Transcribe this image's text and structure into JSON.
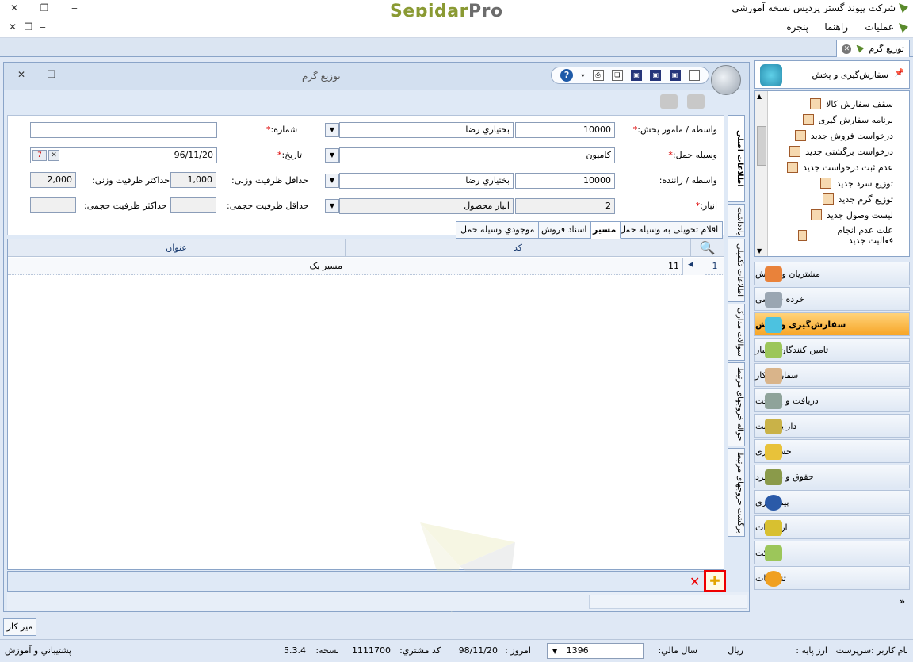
{
  "app": {
    "title": "شرکت پیوند گستر پردیس نسخه آموزشی",
    "logo_main": "Sepidar",
    "logo_pro": "Pro"
  },
  "menu": {
    "items": [
      "عملیات",
      "راهنما",
      "پنجره"
    ]
  },
  "doc_tab": {
    "label": "توزیع گرم"
  },
  "window": {
    "title": "توزیع گرم"
  },
  "form": {
    "agent_label": "واسطه / مامور پخش:",
    "agent_code": "10000",
    "agent_name": "بختياري رضا",
    "number_label": "شماره:",
    "number_value": "",
    "vehicle_label": "وسیله حمل:",
    "vehicle_value": "کامیون",
    "date_label": "تاریخ:",
    "date_value": "96/11/20",
    "driver_label": "واسطه / راننده:",
    "driver_code": "10000",
    "driver_name": "بختياري رضا",
    "min_weight_label": "حداقل ظرفیت وزنی:",
    "min_weight_value": "1,000",
    "max_weight_label": "حداکثر ظرفیت وزنی:",
    "max_weight_value": "2,000",
    "warehouse_label": "انبار:",
    "warehouse_code": "2",
    "warehouse_name": "انبار محصول",
    "min_volume_label": "حداقل ظرفیت حجمی:",
    "min_volume_value": "",
    "max_volume_label": "حداکثر ظرفیت حجمی:",
    "max_volume_value": ""
  },
  "sub_tabs": [
    "اقلام تحویلی به وسیله حمل",
    "مسیر",
    "اسناد فروش",
    "موجودي وسيله حمل"
  ],
  "grid": {
    "columns": [
      "کد",
      "عنوان"
    ],
    "rows": [
      {
        "index": "1",
        "code": "11",
        "title": "مسیر یک"
      }
    ]
  },
  "vertical_tabs": [
    "اطلاعات اصلی",
    "یادداشت",
    "اطلاعات تکمیلی",
    "سوالات مدارک",
    "حواله خروجهای مرتبط",
    "برگشت خروجهای مرتبط"
  ],
  "right_panel": {
    "header": "سفارش‌گیری و پخش",
    "items": [
      "سقف سفارش کالا",
      "برنامه سفارش گیری",
      "درخواست فروش جدید",
      "درخواست برگشتی جدید",
      "عدم ثبت درخواست جدید",
      "توزیع سرد جدید",
      "توزیع گرم جدید",
      "لیست وصول جدید",
      "علت عدم انجام فعالیت جدید"
    ],
    "categories": [
      "مشتریان و فروش",
      "خرده فروشی",
      "سفارش‌گیری و پخش",
      "تامین کنندگان و انبار",
      "سفارش کار",
      "دریافت و پرداخت",
      "دارایی ثابت",
      "حسابداری",
      "حقوق و دستمزد",
      "پیمانکاری",
      "ارتباطات",
      "شرکت",
      "تنظیمات"
    ]
  },
  "bottom": {
    "desk_button": "میز کار"
  },
  "footer": {
    "user_label": "نام کاربر :سرپرست",
    "currency_label": "ارز پایه :",
    "currency_value": "ریال",
    "fiscal_label": "سال مالي:",
    "fiscal_value": "1396",
    "today_label": "امروز :",
    "today_value": "98/11/20",
    "customer_label": "کد مشتري:",
    "customer_value": "1111700",
    "version_label": "نسخه:",
    "version_value": "5.3.4",
    "support": "پشتيباني و آموزش"
  },
  "colors": {
    "accent": "#f7a526",
    "required": "#dd0000",
    "border": "#8aa4c8"
  }
}
